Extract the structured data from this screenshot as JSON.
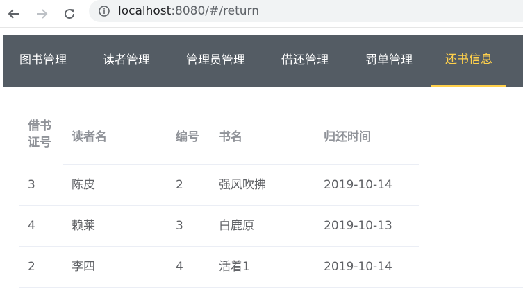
{
  "browser": {
    "url_host": "localhost",
    "url_rest": ":8080/#/return"
  },
  "nav": {
    "items": [
      {
        "label": "图书管理"
      },
      {
        "label": "读者管理"
      },
      {
        "label": "管理员管理"
      },
      {
        "label": "借还管理"
      },
      {
        "label": "罚单管理"
      },
      {
        "label": "还书信息"
      }
    ],
    "active_index": 5,
    "background": "#545c64",
    "active_color": "#ffd04b"
  },
  "table": {
    "headers": {
      "card_id_line1": "借书",
      "card_id_line2": "证号",
      "reader_name": "读者名",
      "book_id": "编号",
      "book_name": "书名",
      "return_time": "归还时间"
    },
    "rows": [
      {
        "card_id": "3",
        "reader_name": "陈皮",
        "book_id": "2",
        "book_name": "强风吹拂",
        "return_time": "2019-10-14"
      },
      {
        "card_id": "4",
        "reader_name": "赖莱",
        "book_id": "3",
        "book_name": "白鹿原",
        "return_time": "2019-10-13"
      },
      {
        "card_id": "2",
        "reader_name": "李四",
        "book_id": "4",
        "book_name": "活着1",
        "return_time": "2019-10-14"
      }
    ]
  }
}
